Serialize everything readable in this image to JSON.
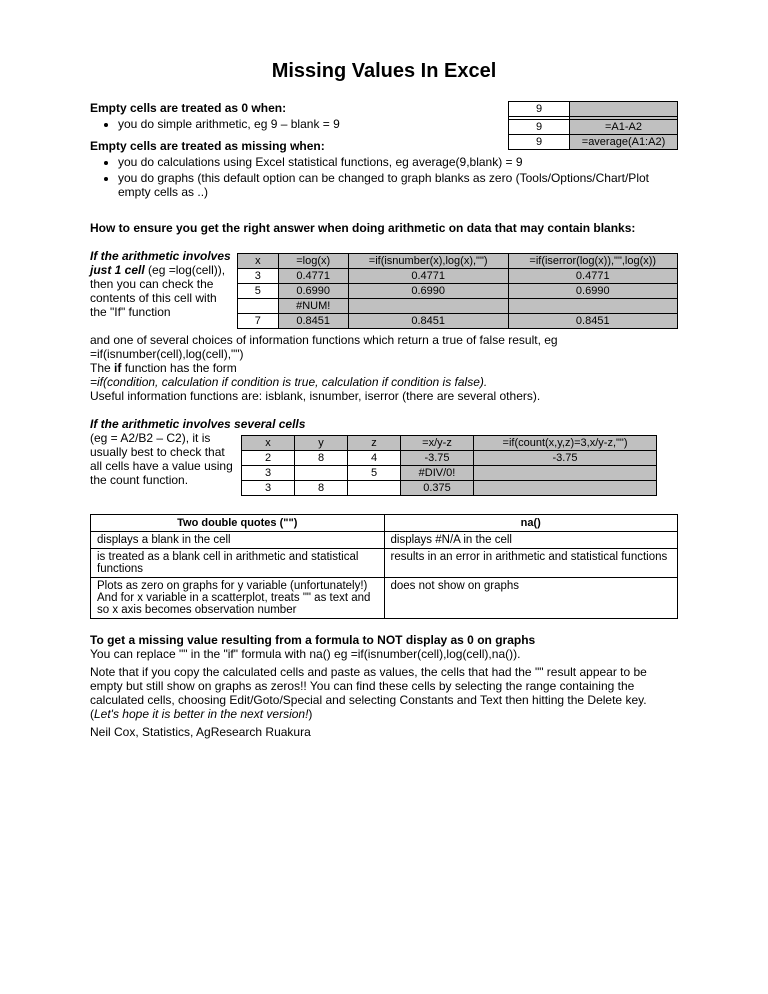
{
  "title": "Missing Values In Excel",
  "s1": {
    "h": "Empty cells are treated as 0 when:",
    "b1": "you do simple arithmetic, eg 9 – blank = 9"
  },
  "s2": {
    "h": "Empty cells are treated as missing when:",
    "b1": "you do calculations using Excel statistical functions, eg average(9,blank) = 9",
    "b2": "you do graphs (this default option can be changed to graph blanks as zero (Tools/Options/Chart/Plot empty cells as ..)"
  },
  "floatTbl": {
    "r1c1": "9",
    "r1c2": "",
    "r2c1": "",
    "r2c2": "",
    "r3c1": "9",
    "r3c2": "=A1-A2",
    "r4c1": "9",
    "r4c2": "=average(A1:A2)"
  },
  "s3": {
    "h": "How to ensure you get the right answer when doing arithmetic on data that may contain blanks:"
  },
  "s4": {
    "lead1": "If the arithmetic involves just 1 cell",
    "lead2": " (eg =log(cell)), then you can check the contents of this cell with the \"If\" function",
    "after1": "and one of several choices of information functions which return a true of false result, eg =if(isnumber(cell),log(cell),\"\")",
    "after2a": "The ",
    "after2b": "if",
    "after2c": " function has the form",
    "after3": "=if(condition, calculation if condition is true, calculation if condition is false).",
    "after4": "Useful information functions are: isblank, isnumber, iserror (there are several others)."
  },
  "tbl1": {
    "h1": "x",
    "h2": "=log(x)",
    "h3": "=if(isnumber(x),log(x),\"\")",
    "h4": "=if(iserror(log(x)),\"\",log(x))",
    "r1": [
      "3",
      "0.4771",
      "0.4771",
      "0.4771"
    ],
    "r2": [
      "5",
      "0.6990",
      "0.6990",
      "0.6990"
    ],
    "r3": [
      "",
      "#NUM!",
      "",
      ""
    ],
    "r4": [
      "7",
      "0.8451",
      "0.8451",
      "0.8451"
    ]
  },
  "s5": {
    "lead1": "If the arithmetic involves several cells",
    "lead2": " (eg = A2/B2 – C2), it is usually best to check that all cells have a value using the count function."
  },
  "tbl2": {
    "h1": "x",
    "h2": "y",
    "h3": "z",
    "h4": "=x/y-z",
    "h5": "=if(count(x,y,z)=3,x/y-z,\"\")",
    "r1": [
      "2",
      "8",
      "4",
      "-3.75",
      "-3.75"
    ],
    "r2": [
      "3",
      "",
      "5",
      "#DIV/0!",
      ""
    ],
    "r3": [
      "3",
      "8",
      "",
      "0.375",
      ""
    ]
  },
  "tbl3": {
    "h1": "Two double quotes (\"\")",
    "h2": "na()",
    "l1": "displays a blank in the cell",
    "r1": "displays #N/A in the cell",
    "l2": "is treated as a blank cell in arithmetic and statistical functions",
    "r2": "results in an error in arithmetic and statistical functions",
    "l3": "Plots as zero on graphs for y variable (unfortunately!)\nAnd for x variable in a scatterplot, treats \"\" as text and so x axis becomes observation number",
    "r3": "does not show on graphs"
  },
  "s6": {
    "h": "To get a missing value resulting from a formula to NOT display as 0 on graphs",
    "p1": "You can replace \"\" in the \"if\" formula with na() eg =if(isnumber(cell),log(cell),na()).",
    "p2a": "Note that if you copy the calculated cells and paste as values, the cells that had the \"\" result appear to be empty but still show on graphs as zeros!! You can find these cells by selecting the range containing the calculated cells, choosing Edit/Goto/Special and selecting Constants and Text then hitting the Delete key. (",
    "p2b": "Let's hope it is better in the next version!",
    "p2c": ")"
  },
  "footer": "Neil Cox, Statistics, AgResearch Ruakura"
}
